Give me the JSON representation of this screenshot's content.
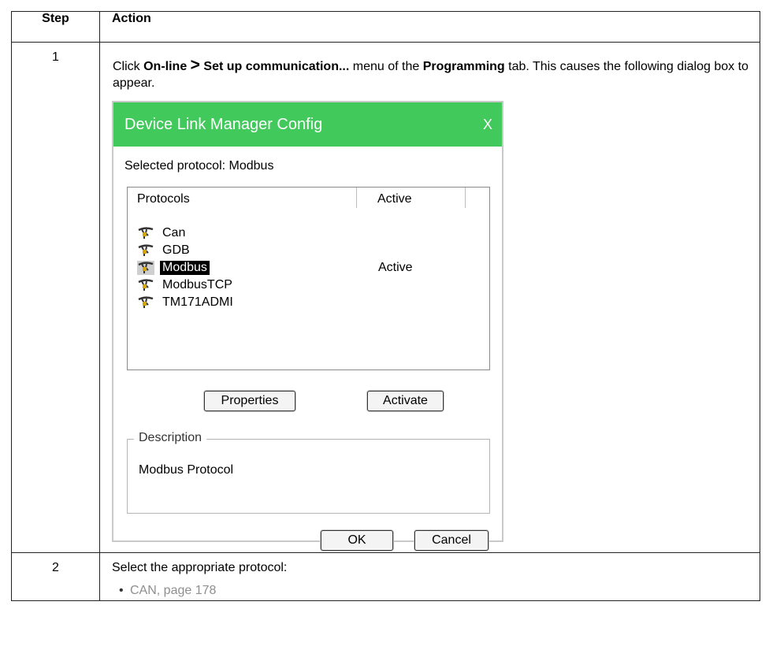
{
  "table": {
    "header_step": "Step",
    "header_action": "Action"
  },
  "step1": {
    "number": "1",
    "text_click": "Click ",
    "menu_online": "On-line",
    "arrow": ">",
    "menu_setup": "Set up communication...",
    "text_menu_of": " menu of the ",
    "tab_programming": "Programming",
    "text_tail": " tab. This causes the following dialog box to appear."
  },
  "dialog": {
    "title": "Device Link Manager Config",
    "close_label": "X",
    "selected_protocol_label": "Selected protocol: Modbus",
    "columns": {
      "protocols": "Protocols",
      "active": "Active"
    },
    "protocols": [
      {
        "name": "Can",
        "active": "",
        "selected": false
      },
      {
        "name": "GDB",
        "active": "",
        "selected": false
      },
      {
        "name": "Modbus",
        "active": "Active",
        "selected": true
      },
      {
        "name": "ModbusTCP",
        "active": "",
        "selected": false
      },
      {
        "name": "TM171ADMI",
        "active": "",
        "selected": false
      }
    ],
    "properties_button": "Properties",
    "activate_button": "Activate",
    "description_legend": "Description",
    "description_text": "Modbus Protocol",
    "ok_button": "OK",
    "cancel_button": "Cancel"
  },
  "step2": {
    "number": "2",
    "intro": "Select the appropriate protocol:",
    "links": [
      "CAN, page 178"
    ]
  },
  "colors": {
    "title_bar": "#41c95b",
    "link_gray": "#8f8f8f",
    "selection": "#000000"
  },
  "icons": {
    "protocol": "plug-connector-icon"
  }
}
